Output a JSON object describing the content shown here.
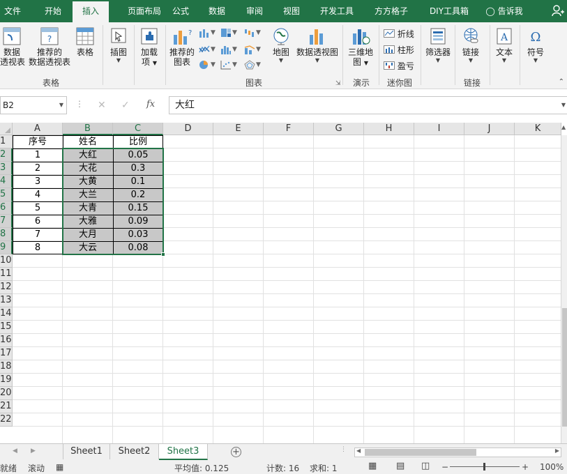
{
  "ribbon_tabs": [
    "文件",
    "开始",
    "插入",
    "页面布局",
    "公式",
    "数据",
    "审阅",
    "视图",
    "开发工具",
    "方方格子",
    "DIY工具箱",
    "告诉我"
  ],
  "active_tab": "插入",
  "ribbon": {
    "pivot_table": [
      "数据",
      "透视表"
    ],
    "recommended_pivot": [
      "推荐的",
      "数据透视表"
    ],
    "table": "表格",
    "group_tables": "表格",
    "illustrations": "插图",
    "addins": [
      "加载",
      "项"
    ],
    "recommended_charts": [
      "推荐的",
      "图表"
    ],
    "group_charts": "图表",
    "maps": "地图",
    "pivot_chart": "数据透视图",
    "threed_map": [
      "三维地",
      "图"
    ],
    "group_tours": "演示",
    "spark_line": "折线",
    "spark_column": "柱形",
    "spark_winloss": "盈亏",
    "group_sparklines": "迷你图",
    "slicer": "筛选器",
    "link": "链接",
    "group_links": "链接",
    "text": "文本",
    "symbols": "符号"
  },
  "formula_bar": {
    "name_box": "B2",
    "fx": "fx",
    "content": "大红"
  },
  "columns": [
    "A",
    "B",
    "C",
    "D",
    "E",
    "F",
    "G",
    "H",
    "I",
    "J",
    "K"
  ],
  "rows": [
    "1",
    "2",
    "3",
    "4",
    "5",
    "6",
    "7",
    "8",
    "9",
    "10",
    "11",
    "12",
    "13",
    "14",
    "15",
    "16",
    "17",
    "18",
    "19",
    "20",
    "21",
    "22"
  ],
  "table": {
    "headers": [
      "序号",
      "姓名",
      "比例"
    ],
    "rows": [
      [
        "1",
        "大红",
        "0.05"
      ],
      [
        "2",
        "大花",
        "0.3"
      ],
      [
        "3",
        "大黄",
        "0.1"
      ],
      [
        "4",
        "大兰",
        "0.2"
      ],
      [
        "5",
        "大青",
        "0.15"
      ],
      [
        "6",
        "大雅",
        "0.09"
      ],
      [
        "7",
        "大月",
        "0.03"
      ],
      [
        "8",
        "大云",
        "0.08"
      ]
    ]
  },
  "sheets": [
    "Sheet1",
    "Sheet2",
    "Sheet3"
  ],
  "active_sheet": "Sheet3",
  "status": {
    "mode": "就绪",
    "scroll": "滚动",
    "average": "平均值: 0.125",
    "count": "计数: 16",
    "sum": "求和: 1",
    "zoom": "100%"
  },
  "colors": {
    "accent": "#217346",
    "selection_fill": "#c8c8c8"
  }
}
